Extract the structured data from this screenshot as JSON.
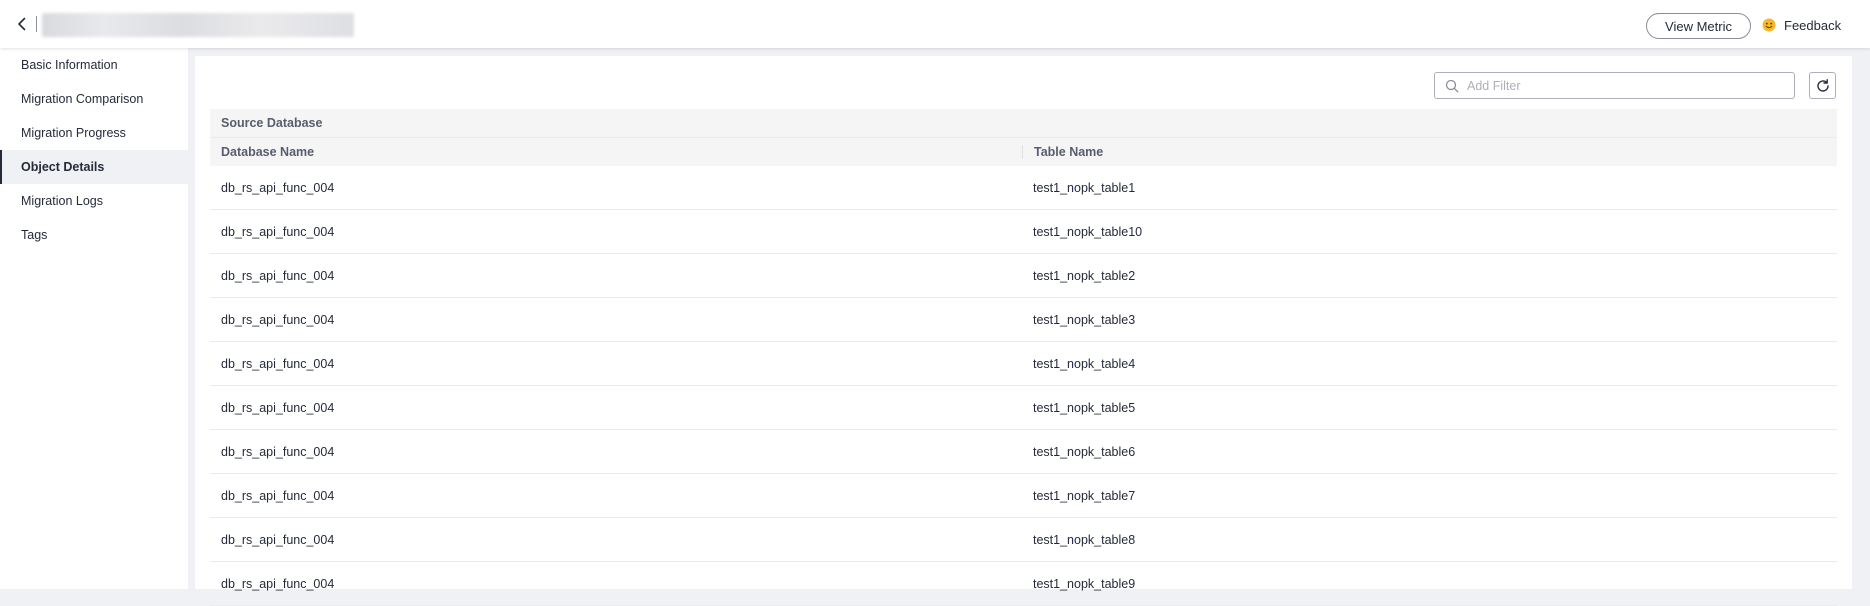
{
  "header": {
    "view_metric_label": "View Metric",
    "feedback_label": "Feedback"
  },
  "sidebar": {
    "items": [
      {
        "label": "Basic Information"
      },
      {
        "label": "Migration Comparison"
      },
      {
        "label": "Migration Progress"
      },
      {
        "label": "Object Details",
        "active": true
      },
      {
        "label": "Migration Logs"
      },
      {
        "label": "Tags"
      }
    ]
  },
  "toolbar": {
    "filter_placeholder": "Add Filter",
    "filter_value": ""
  },
  "table": {
    "group_header": "Source Database",
    "columns": [
      "Database Name",
      "Table Name"
    ],
    "rows": [
      [
        "db_rs_api_func_004",
        "test1_nopk_table1"
      ],
      [
        "db_rs_api_func_004",
        "test1_nopk_table10"
      ],
      [
        "db_rs_api_func_004",
        "test1_nopk_table2"
      ],
      [
        "db_rs_api_func_004",
        "test1_nopk_table3"
      ],
      [
        "db_rs_api_func_004",
        "test1_nopk_table4"
      ],
      [
        "db_rs_api_func_004",
        "test1_nopk_table5"
      ],
      [
        "db_rs_api_func_004",
        "test1_nopk_table6"
      ],
      [
        "db_rs_api_func_004",
        "test1_nopk_table7"
      ],
      [
        "db_rs_api_func_004",
        "test1_nopk_table8"
      ],
      [
        "db_rs_api_func_004",
        "test1_nopk_table9"
      ]
    ]
  },
  "icons": {
    "back": "chevron-left-icon",
    "feedback": "smile-icon",
    "search": "search-icon",
    "refresh": "refresh-icon"
  },
  "colors": {
    "accent_smile": "#f5b72b",
    "text_primary": "#252b3a",
    "page_bg": "#f0f1f4"
  }
}
